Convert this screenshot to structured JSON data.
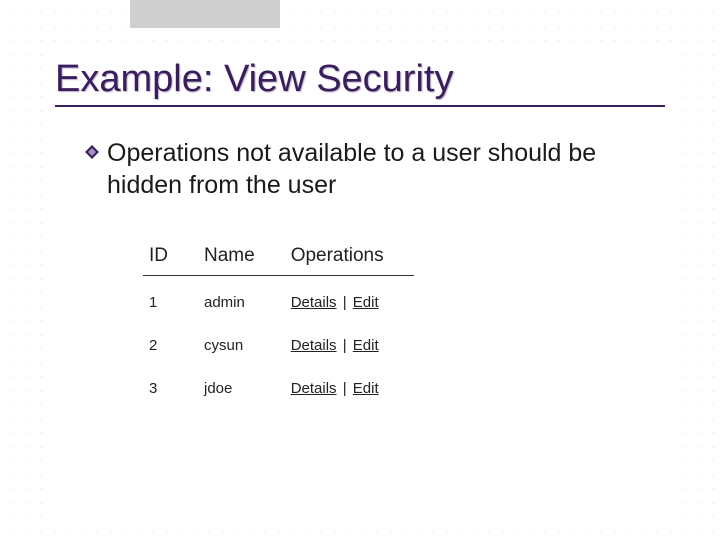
{
  "title": "Example: View Security",
  "bullet": "Operations not available to a user should be hidden from the user",
  "table": {
    "headers": {
      "id": "ID",
      "name": "Name",
      "operations": "Operations"
    },
    "rows": [
      {
        "id": "1",
        "name": "admin",
        "op_details": "Details",
        "op_sep": " | ",
        "op_edit": "Edit"
      },
      {
        "id": "2",
        "name": "cysun",
        "op_details": "Details",
        "op_sep": " | ",
        "op_edit": "Edit"
      },
      {
        "id": "3",
        "name": "jdoe",
        "op_details": "Details",
        "op_sep": " | ",
        "op_edit": "Edit"
      }
    ]
  }
}
